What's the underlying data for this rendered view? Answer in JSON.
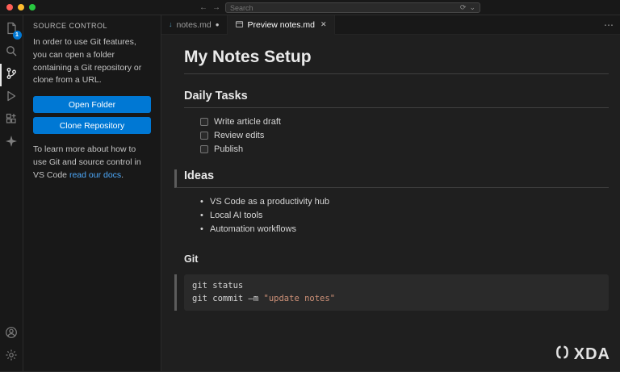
{
  "titlebar": {
    "search": {
      "placeholder": "Search"
    },
    "icons": {
      "back": "←",
      "forward": "→",
      "sync": "⟳",
      "chevron_down": "⌄"
    }
  },
  "activity_bar": {
    "items": [
      {
        "label": "Explorer",
        "badge": "1"
      },
      {
        "label": "Search"
      },
      {
        "label": "Source Control",
        "active": true
      },
      {
        "label": "Run and Debug"
      },
      {
        "label": "Extensions"
      },
      {
        "label": "Copilot"
      }
    ],
    "bottom_items": [
      {
        "label": "Accounts"
      },
      {
        "label": "Manage"
      }
    ]
  },
  "sidebar": {
    "title": "SOURCE CONTROL",
    "intro_text": "In order to use Git features, you can open a folder containing a Git repository or clone from a URL.",
    "open_folder_label": "Open Folder",
    "clone_repository_label": "Clone Repository",
    "docs_text_before": "To learn more about how to use Git and source control in VS Code ",
    "docs_link_label": "read our docs",
    "docs_text_after": "."
  },
  "editor": {
    "tabs": [
      {
        "label": "notes.md",
        "modified_dot": "●"
      },
      {
        "label": "Preview notes.md",
        "close": "✕"
      }
    ],
    "more_actions": "⋯"
  },
  "preview": {
    "h1": "My Notes Setup",
    "daily_tasks_heading": "Daily Tasks",
    "tasks": [
      "Write article draft",
      "Review edits",
      "Publish"
    ],
    "ideas_heading": "Ideas",
    "ideas": [
      "VS Code as a productivity hub",
      "Local AI tools",
      "Automation workflows"
    ],
    "git_heading": "Git",
    "code": {
      "line1": "git status",
      "line2_prefix": "git commit —m ",
      "line2_string": "\"update notes\""
    }
  },
  "watermark": {
    "brand": "XDA"
  }
}
